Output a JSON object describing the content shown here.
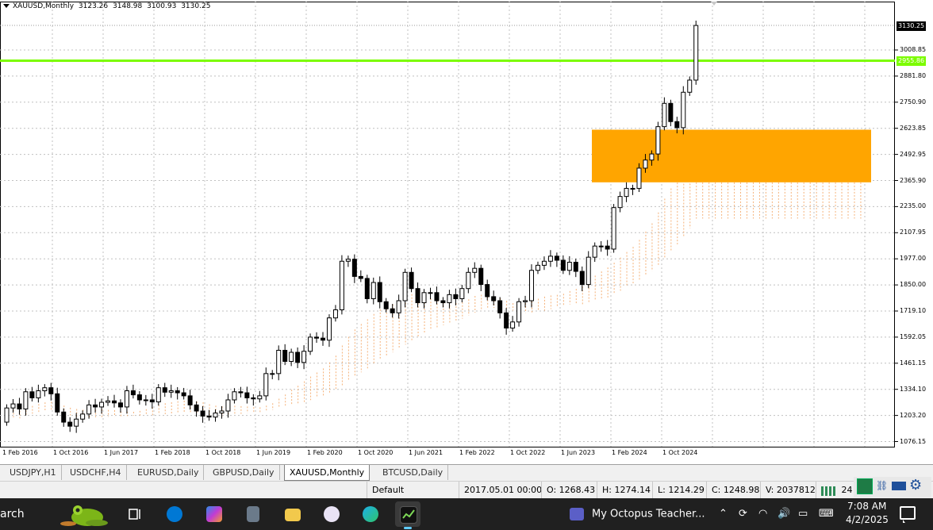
{
  "chart_header": {
    "symbol": "XAUUSD,Monthly",
    "open": "3123.26",
    "high": "3148.98",
    "low": "3100.93",
    "close": "3130.25"
  },
  "price_tags": {
    "current": "3130.25",
    "hline": "2955.86"
  },
  "colors": {
    "hline": "#7CFC00",
    "zone": "#FFA500",
    "cloud_a": "#F4A460",
    "cloud_b": "#D8BFD8",
    "grid": "#C0C0C0"
  },
  "chart_data": {
    "type": "candlestick",
    "y_ticks": [
      "3008.85",
      "2881.80",
      "2750.90",
      "2623.85",
      "2492.95",
      "2365.90",
      "2235.00",
      "2107.95",
      "1977.00",
      "1850.00",
      "1719.10",
      "1592.05",
      "1461.15",
      "1334.10",
      "1203.20",
      "1076.15"
    ],
    "x_ticks": [
      "1 Feb 2016",
      "1 Oct 2016",
      "1 Jun 2017",
      "1 Feb 2018",
      "1 Oct 2018",
      "1 Jun 2019",
      "1 Feb 2020",
      "1 Oct 2020",
      "1 Jun 2021",
      "1 Feb 2022",
      "1 Oct 2022",
      "1 Jun 2023",
      "1 Feb 2024",
      "1 Oct 2024"
    ],
    "ylim": [
      1060,
      3180
    ],
    "horizontal_line": 2955.86,
    "zone": {
      "from": 2355,
      "to": 2615
    },
    "closes": [
      1240,
      1260,
      1235,
      1320,
      1290,
      1325,
      1340,
      1310,
      1220,
      1170,
      1150,
      1185,
      1210,
      1255,
      1245,
      1268,
      1275,
      1265,
      1245,
      1325,
      1305,
      1280,
      1280,
      1270,
      1340,
      1318,
      1325,
      1315,
      1300,
      1255,
      1225,
      1200,
      1195,
      1215,
      1225,
      1280,
      1320,
      1315,
      1290,
      1285,
      1300,
      1410,
      1410,
      1525,
      1470,
      1515,
      1465,
      1520,
      1590,
      1585,
      1575,
      1685,
      1725,
      1965,
      1975,
      1890,
      1880,
      1780,
      1860,
      1765,
      1730,
      1710,
      1770,
      1910,
      1830,
      1760,
      1810,
      1810,
      1770,
      1760,
      1800,
      1780,
      1830,
      1910,
      1930,
      1850,
      1790,
      1770,
      1710,
      1635,
      1665,
      1765,
      1770,
      1920,
      1945,
      1965,
      1990,
      1970,
      1920,
      1960,
      1915,
      1850,
      1985,
      2040,
      2040,
      2025,
      2230,
      2285,
      2325,
      2325,
      2425,
      2465,
      2495,
      2630,
      2745,
      2655,
      2625,
      2800,
      2860,
      3130
    ]
  },
  "chart_tabs": [
    {
      "label": "USDJPY,H1"
    },
    {
      "label": "USDCHF,H4"
    },
    {
      "label": "EURUSD,Daily"
    },
    {
      "label": "GBPUSD,Daily"
    },
    {
      "label": "XAUUSD,Monthly",
      "active": true
    },
    {
      "label": "BTCUSD,Daily"
    }
  ],
  "status_bar": {
    "profile": "Default",
    "datetime": "2017.05.01 00:00",
    "open": "O: 1268.43",
    "high": "H: 1274.14",
    "low": "L: 1214.29",
    "close": "C: 1248.98",
    "volume": "V: 2037812",
    "connection": "24"
  },
  "taskbar": {
    "search_text": "arch",
    "media_title": "My Octopus Teacher...",
    "time": "7:08 AM",
    "date": "4/2/2025",
    "apps": [
      "task-view",
      "skype",
      "copilot",
      "calculator",
      "file-explorer",
      "paint",
      "edge",
      "ic-markets"
    ]
  }
}
